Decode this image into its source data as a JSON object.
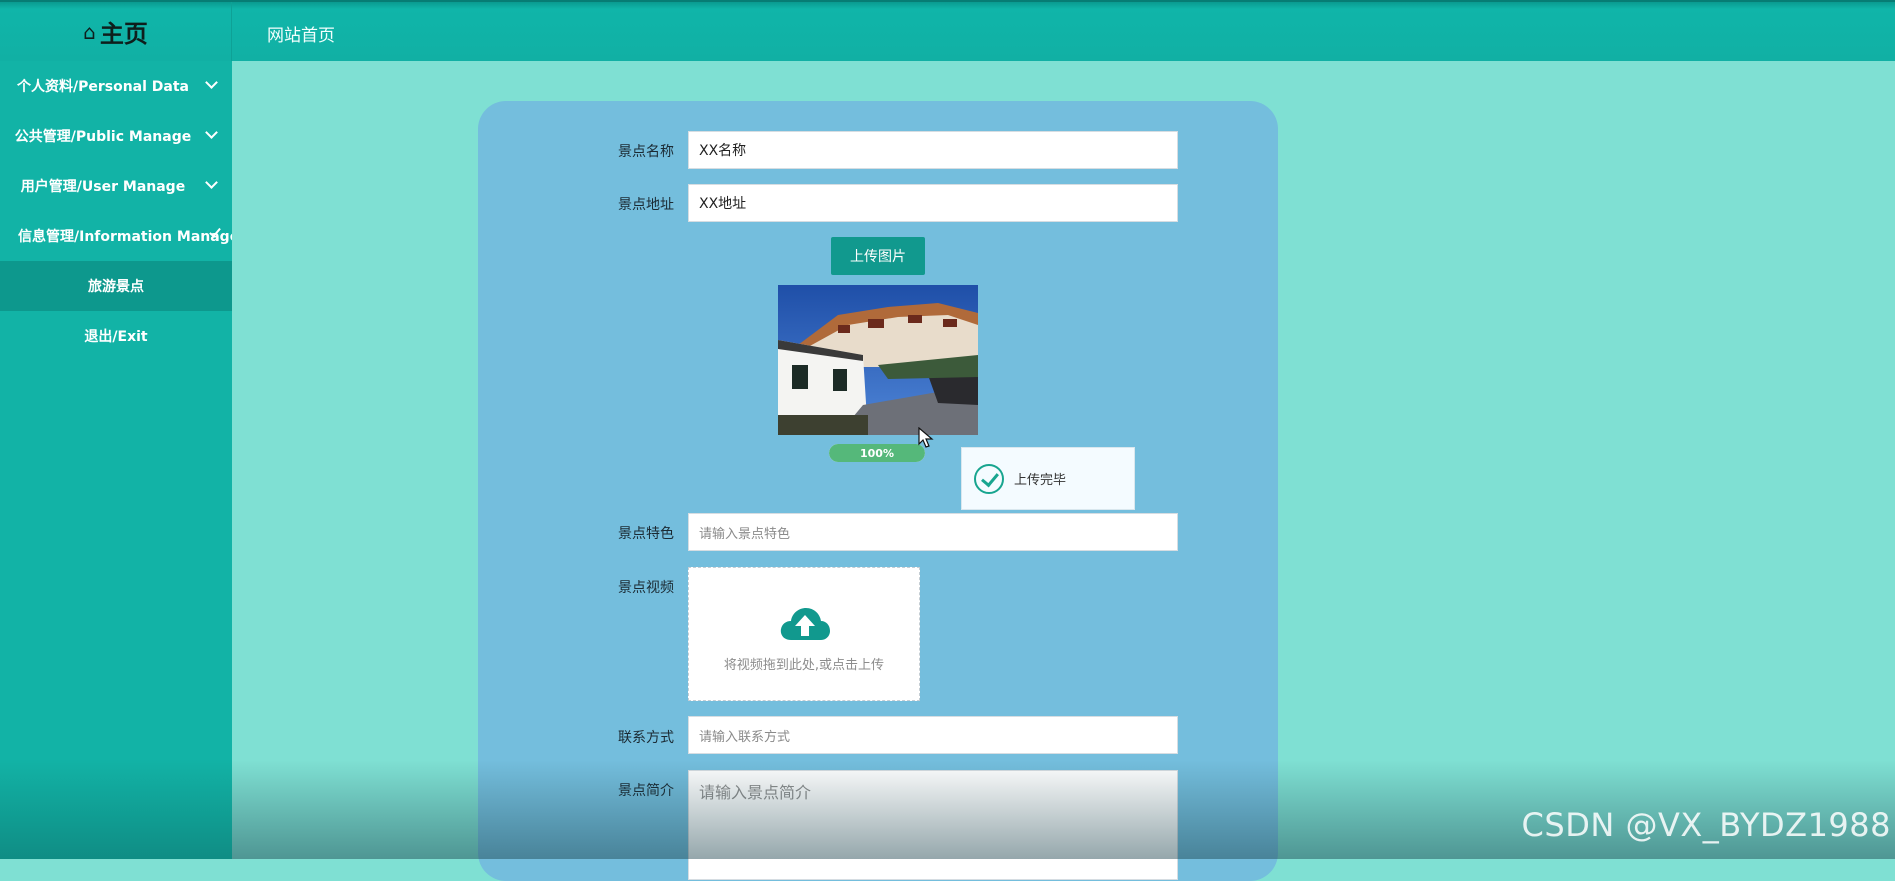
{
  "header": {
    "brand_icon": "home-icon",
    "brand_title": "主页",
    "breadcrumb": "网站首页"
  },
  "sidebar": {
    "items": [
      {
        "label": "个人资料/Personal Data",
        "expandable": true
      },
      {
        "label": "公共管理/Public Manage",
        "expandable": true
      },
      {
        "label": "用户管理/User Manage",
        "expandable": true
      },
      {
        "label": "信息管理/Information Manage",
        "expandable": true
      },
      {
        "label": "旅游景点",
        "active": true
      },
      {
        "label": "退出/Exit"
      }
    ]
  },
  "form": {
    "name_label": "景点名称",
    "name_value": "XX名称",
    "address_label": "景点地址",
    "address_value": "XX地址",
    "upload_image_button": "上传图片",
    "upload_progress": 100,
    "upload_progress_text": "100%",
    "toast_message": "上传完毕",
    "feature_label": "景点特色",
    "feature_placeholder": "请输入景点特色",
    "video_label": "景点视频",
    "video_hint": "将视频拖到此处,或点击上传",
    "contact_label": "联系方式",
    "contact_placeholder": "请输入联系方式",
    "intro_label": "景点简介",
    "intro_placeholder": "请输入景点简介"
  },
  "watermark": "CSDN @VX_BYDZ1988",
  "colors": {
    "accent": "#11998e",
    "sidebar": "#12b3a6",
    "page_bg": "#7fe0d3",
    "panel_bg": "#74bedd"
  }
}
